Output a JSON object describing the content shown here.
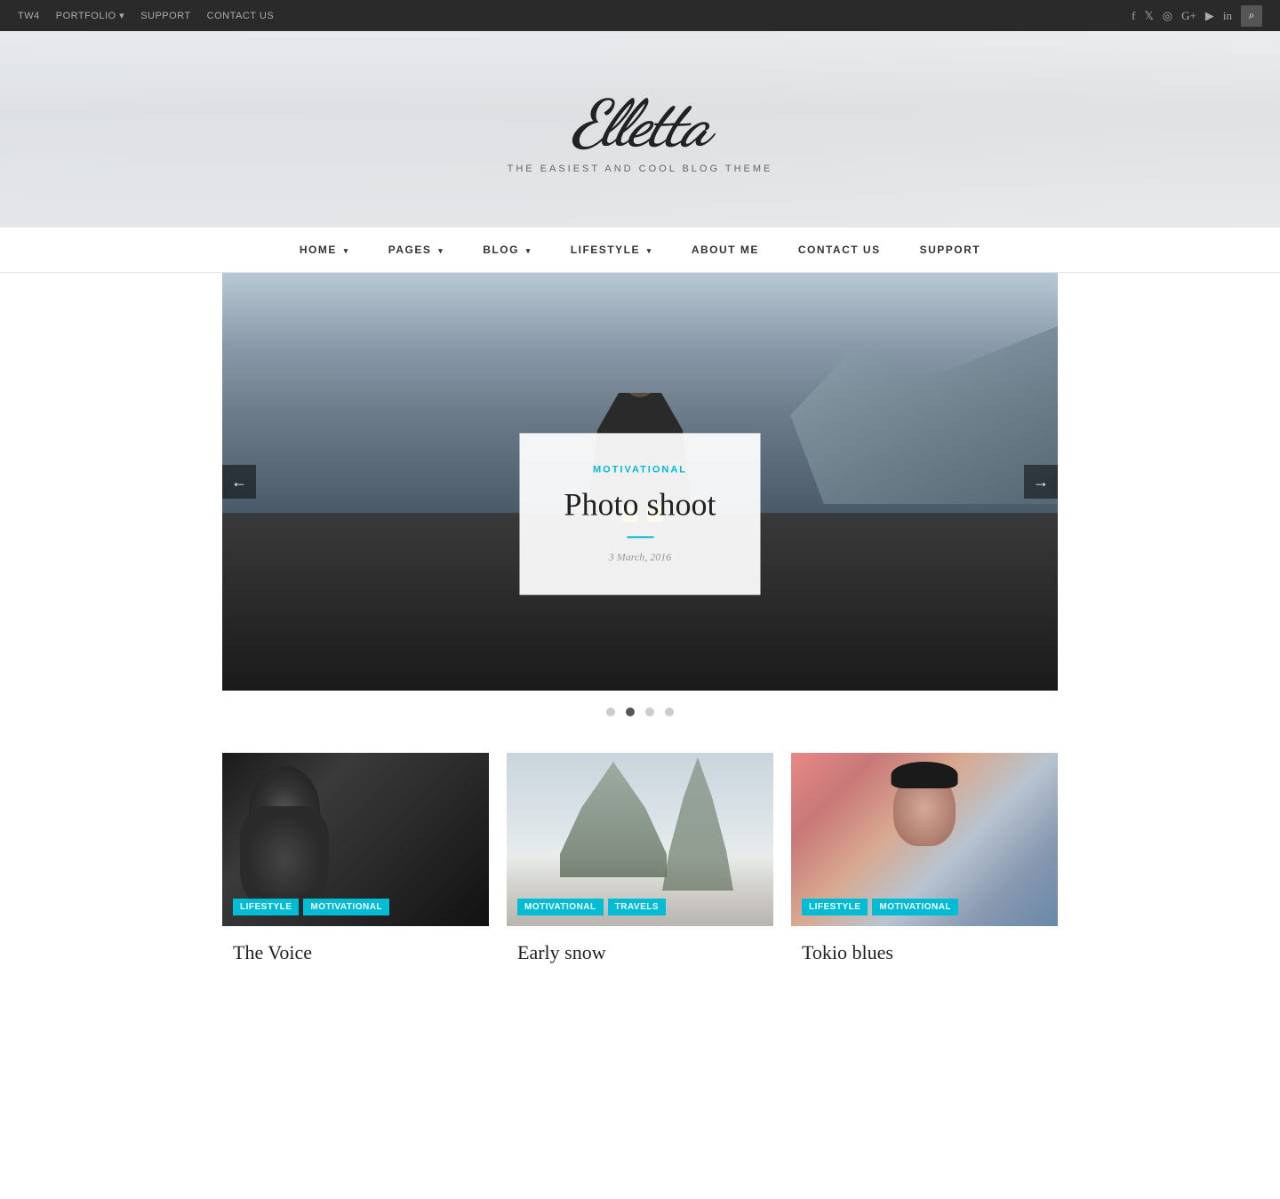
{
  "topbar": {
    "links": [
      "TW4",
      "PORTFOLIO",
      "SUPPORT",
      "CONTACT US"
    ],
    "portfolio_arrow": "▾",
    "social_icons": [
      "f",
      "🐦",
      "📷",
      "g+",
      "▶",
      "in"
    ],
    "search_icon": "🔍"
  },
  "header": {
    "site_title": "Elletta",
    "tagline": "THE EASIEST AND COOL BLOG THEME"
  },
  "nav": {
    "items": [
      {
        "label": "HOME",
        "has_arrow": true
      },
      {
        "label": "PAGES",
        "has_arrow": true
      },
      {
        "label": "BLOG",
        "has_arrow": true
      },
      {
        "label": "LIFESTYLE",
        "has_arrow": true
      },
      {
        "label": "ABOUT ME",
        "has_arrow": false
      },
      {
        "label": "CONTACT US",
        "has_arrow": false
      },
      {
        "label": "SUPPORT",
        "has_arrow": false
      }
    ]
  },
  "slider": {
    "category": "MOTIVATIONAL",
    "title": "Photo shoot",
    "date": "3 March, 2016",
    "prev_label": "←",
    "next_label": "→",
    "dots": [
      {
        "active": false,
        "index": 0
      },
      {
        "active": true,
        "index": 1
      },
      {
        "active": false,
        "index": 2
      },
      {
        "active": false,
        "index": 3
      }
    ]
  },
  "cards": [
    {
      "tags": [
        "LIFESTYLE",
        "MOTIVATIONAL"
      ],
      "title": "The Voice",
      "image_type": "bw-man"
    },
    {
      "tags": [
        "MOTIVATIONAL",
        "TRAVELS"
      ],
      "title": "Early snow",
      "image_type": "snow-scene"
    },
    {
      "tags": [
        "LIFESTYLE",
        "MOTIVATIONAL"
      ],
      "title": "Tokio blues",
      "image_type": "asian-woman"
    }
  ]
}
